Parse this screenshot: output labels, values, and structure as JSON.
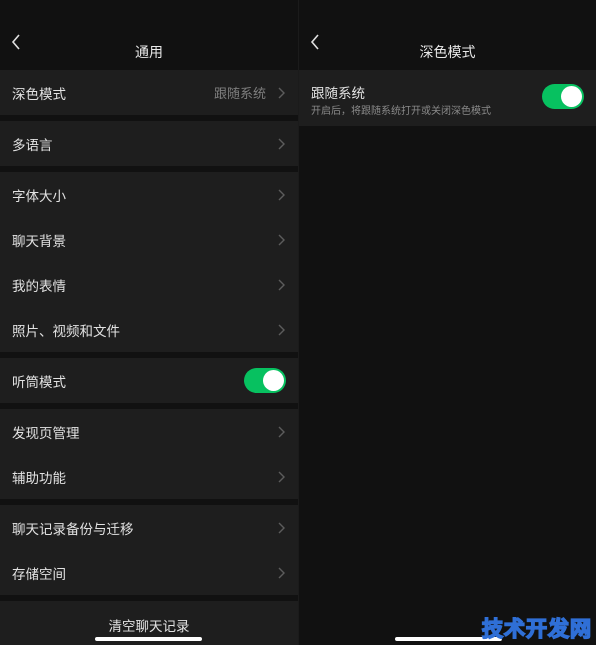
{
  "left": {
    "title": "通用",
    "groups": [
      {
        "items": [
          {
            "label": "深色模式",
            "value": "跟随系统"
          }
        ]
      },
      {
        "items": [
          {
            "label": "多语言"
          }
        ]
      },
      {
        "items": [
          {
            "label": "字体大小"
          },
          {
            "label": "聊天背景"
          },
          {
            "label": "我的表情"
          },
          {
            "label": "照片、视频和文件"
          }
        ]
      },
      {
        "items": [
          {
            "label": "听筒模式",
            "toggle": true
          }
        ]
      },
      {
        "items": [
          {
            "label": "发现页管理"
          },
          {
            "label": "辅助功能"
          }
        ]
      },
      {
        "items": [
          {
            "label": "聊天记录备份与迁移"
          },
          {
            "label": "存储空间"
          }
        ]
      }
    ],
    "clear_label": "清空聊天记录"
  },
  "right": {
    "title": "深色模式",
    "follow_system": {
      "title": "跟随系统",
      "description": "开启后，将跟随系统打开或关闭深色模式",
      "enabled": true
    }
  },
  "watermark": "技术开发网",
  "colors": {
    "accent": "#07c160",
    "cell": "#1e1e1e",
    "background": "#111111"
  },
  "icons": {
    "back": "chevron-left-icon",
    "arrow": "chevron-right-icon"
  }
}
